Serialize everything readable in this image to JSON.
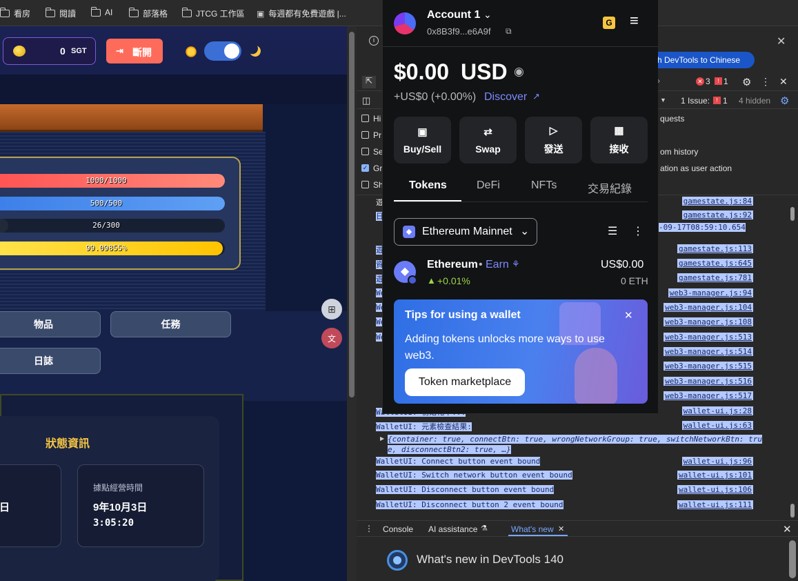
{
  "bookmarks": [
    {
      "label": "看房"
    },
    {
      "label": "閱讀"
    },
    {
      "label": "AI"
    },
    {
      "label": "部落格"
    },
    {
      "label": "JTCG 工作區"
    },
    {
      "label": "每週都有免費遊戲 |..."
    }
  ],
  "game": {
    "sgt_value": "0",
    "sgt_unit": "SGT",
    "disconnect_label": "斷開",
    "bars": [
      {
        "text": "1000/1000",
        "fill": 1.0,
        "color": "#ff6b6b"
      },
      {
        "text": "500/500",
        "fill": 1.0,
        "color": "#4a8cf0"
      },
      {
        "text": "26/300",
        "fill": 0.087,
        "color": "#222a3a"
      },
      {
        "text": "99.09855%",
        "fill": 0.99,
        "color": "#ffd21f"
      }
    ],
    "buttons": {
      "items": "物品",
      "tasks": "任務",
      "log": "日誌"
    },
    "status_title": "狀態資訊",
    "card_left_value": "日",
    "card_right_label": "據點經營時間",
    "card_right_date": "9年10月3日",
    "card_right_time": "3:05:20"
  },
  "wallet": {
    "account_name": "Account 1",
    "address": "0x8B3f9...e6A9f",
    "balance_amount": "$0.00",
    "balance_currency": "USD",
    "change": "+US$0 (+0.00%)",
    "discover": "Discover",
    "actions": {
      "buy_sell": "Buy/Sell",
      "swap": "Swap",
      "send": "發送",
      "receive": "接收"
    },
    "tabs": {
      "tokens": "Tokens",
      "defi": "DeFi",
      "nfts": "NFTs",
      "history": "交易紀錄"
    },
    "network": "Ethereum Mainnet",
    "token": {
      "name": "Ethereum",
      "dot": "•",
      "earn": "Earn",
      "change": "+0.01%",
      "fiat": "US$0.00",
      "amount": "0 ETH"
    },
    "tip": {
      "title": "Tips for using a wallet",
      "body": "Adding tokens unlocks more ways to use web3.",
      "button": "Token marketplace"
    },
    "colors": {
      "accent": "#7b8bff",
      "positive": "#9cd24a",
      "tip_bg": "#3d78e8"
    }
  },
  "devtools": {
    "language_banner": "ch DevTools to Chinese",
    "errors": "3",
    "warnings": "1",
    "issues_label": "1 Issue:",
    "issues_count": "1",
    "hidden": "4 hidden",
    "settings": [
      {
        "prefix": "Hi",
        "suffix": "quests",
        "checked": false
      },
      {
        "prefix": "Pr",
        "suffix": "",
        "checked": false
      },
      {
        "prefix": "Se",
        "suffix": "om history",
        "checked": false
      },
      {
        "prefix": "Gr",
        "suffix": "ation as user action",
        "checked": true
      },
      {
        "prefix": "Sh",
        "suffix": "",
        "checked": false
      }
    ],
    "lines": [
      {
        "msg": "遊",
        "src": "gamestate.js:84",
        "hl": false
      },
      {
        "msg": "日",
        "src": "gamestate.js:92",
        "hl": true
      },
      {
        "msg": "-09-17T08:59:10.654",
        "src": "",
        "hl": true
      },
      {
        "msg": "遊",
        "src": "gamestate.js:113",
        "hl": true
      },
      {
        "msg": "資",
        "src": "gamestate.js:645",
        "hl": true
      },
      {
        "msg": "遊",
        "src": "gamestate.js:781",
        "hl": true
      },
      {
        "msg": "We",
        "src": "web3-manager.js:94",
        "hl": true
      },
      {
        "msg": "We",
        "src": "web3-manager.js:104",
        "hl": true
      },
      {
        "msg": "We",
        "src": "web3-manager.js:108",
        "hl": true
      },
      {
        "msg": "We",
        "src": "web3-manager.js:513",
        "hl": true
      },
      {
        "msg": "",
        "src": "web3-manager.js:514",
        "hl": true
      },
      {
        "msg": "",
        "src": "web3-manager.js:515",
        "hl": true
      },
      {
        "msg": "",
        "src": "web3-manager.js:516",
        "hl": true
      },
      {
        "msg": "",
        "src": "web3-manager.js:517",
        "hl": true
      },
      {
        "msg": "WalletUI: 初始化中...",
        "src": "wallet-ui.js:28",
        "hl": true
      },
      {
        "msg": "WalletUI: 元素檢查結果:",
        "src": "wallet-ui.js:63",
        "hl": true
      },
      {
        "msg": "WalletUI: Connect button event bound",
        "src": "wallet-ui.js:96",
        "hl": true
      },
      {
        "msg": "WalletUI: Switch network button event bound",
        "src": "wallet-ui.js:101",
        "hl": true
      },
      {
        "msg": "WalletUI: Disconnect button event bound",
        "src": "wallet-ui.js:106",
        "hl": true
      },
      {
        "msg": "WalletUI: Disconnect button 2 event bound",
        "src": "wallet-ui.js:111",
        "hl": true
      }
    ],
    "object_line1": "{container: true, connectBtn: true, wrongNetworkGroup: true, switchNetworkBtn: tru",
    "object_line2": "e, disconnectBtn2: true, …}",
    "drawer_tabs": {
      "console": "Console",
      "ai": "AI assistance",
      "whats_new": "What's new"
    },
    "whats_new_title": "What's new in DevTools 140"
  }
}
